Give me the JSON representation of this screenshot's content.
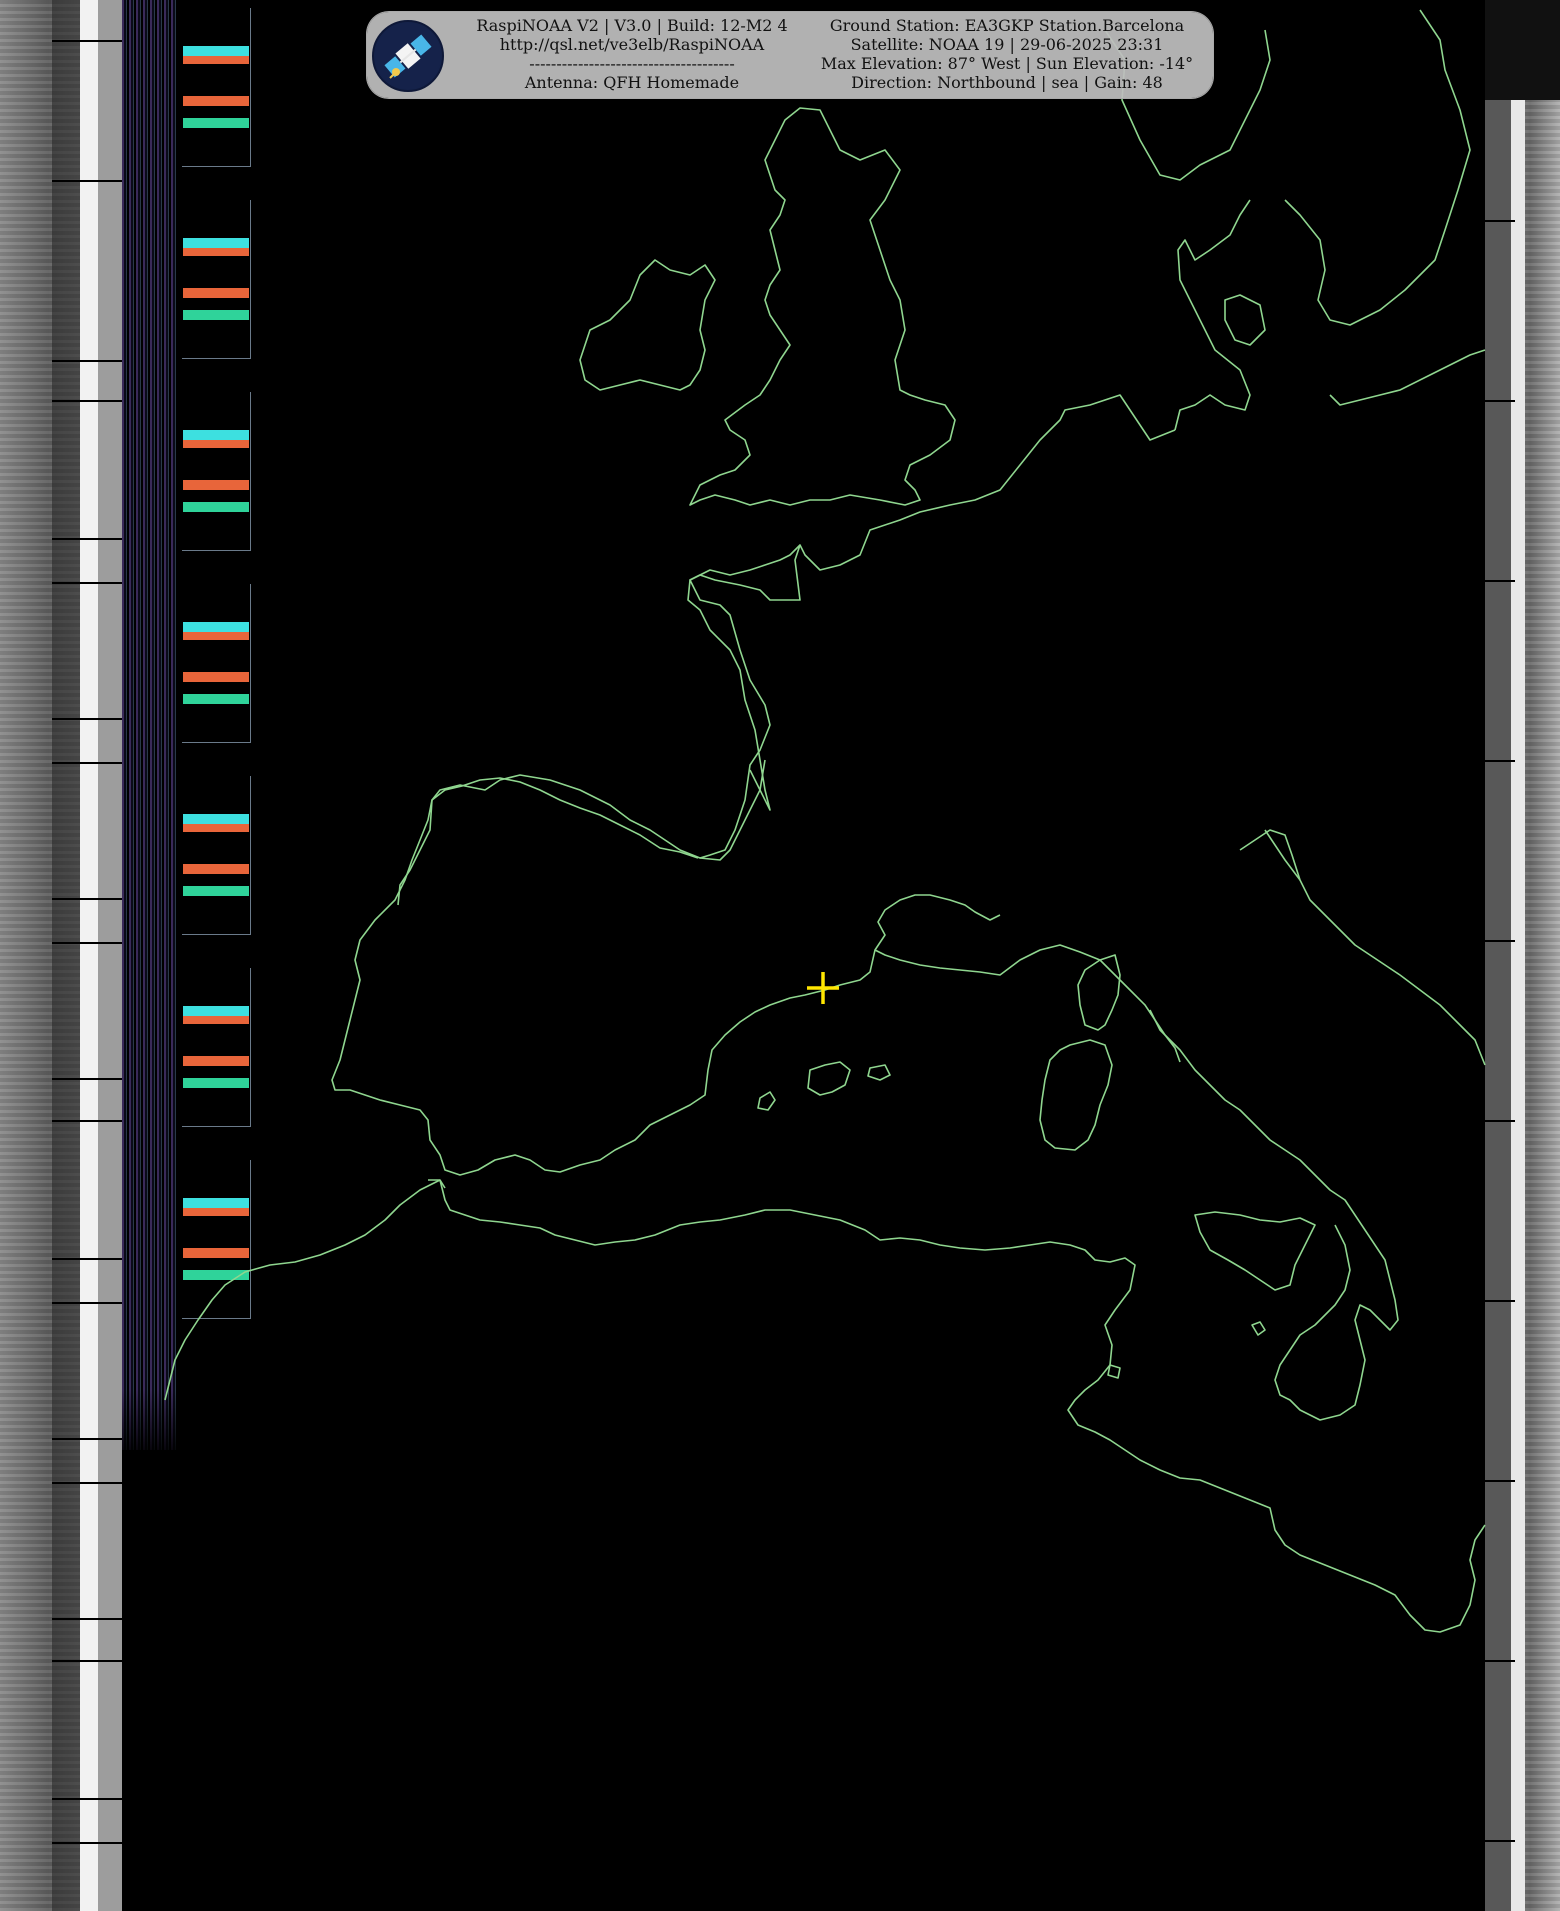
{
  "header": {
    "line1_left": "RaspiNOAA V2 | V3.0 | Build: 12-M2 4",
    "line2_left": "http://qsl.net/ve3elb/RaspiNOAA",
    "line3_left": "--------------------------------------",
    "line4_left": "Antenna: QFH Homemade",
    "line1_right": "Ground Station: EA3GKP Station.Barcelona",
    "line2_right": "Satellite: NOAA 19 | 29-06-2025 23:31",
    "line3_right": "Max Elevation: 87° West | Sun Elevation: -14°",
    "line4_right": "Direction: Northbound | sea | Gain: 48"
  },
  "logo_icon": "satellite-icon",
  "colors": {
    "coastline": "#8fd68f",
    "marker": "#ffe600",
    "panel": "#bebebe",
    "telemetry_cyan": "#3de0e0",
    "telemetry_orange": "#e8653a",
    "telemetry_green": "#2fd39a"
  }
}
